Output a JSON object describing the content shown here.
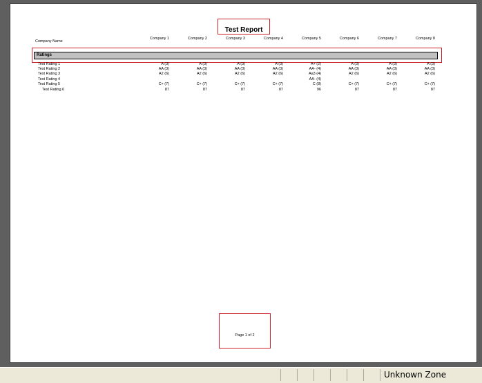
{
  "report": {
    "title": "Test Report",
    "company_name_label": "Company Name",
    "companies": [
      "Company 1",
      "Company 2",
      "Company 3",
      "Company 4",
      "Company 5",
      "Company 6",
      "Company 7",
      "Company 8"
    ],
    "section_title": "Ratings",
    "rows": [
      {
        "label": "Test Rating 1",
        "values": [
          "A (3)",
          "A (3)",
          "A (3)",
          "A (3)",
          "A+ (2)",
          "A (3)",
          "A (3)",
          "A (3)"
        ]
      },
      {
        "label": "Test Rating 2",
        "values": [
          "AA (3)",
          "AA (3)",
          "AA (3)",
          "AA (3)",
          "AA- (4)",
          "AA (3)",
          "AA (3)",
          "AA (3)"
        ]
      },
      {
        "label": "Test Rating 3",
        "values": [
          "A2 (6)",
          "A2 (6)",
          "A2 (6)",
          "A2 (6)",
          "Aa3 (4)",
          "A2 (6)",
          "A2 (6)",
          "A2 (6)"
        ]
      },
      {
        "label": "Test Rating 4",
        "values": [
          "",
          "",
          "",
          "",
          "AA- (4)",
          "",
          "",
          ""
        ]
      },
      {
        "label": "Test Rating 5",
        "values": [
          "C+ (7)",
          "C+ (7)",
          "C+ (7)",
          "C+ (7)",
          "C (8)",
          "C+ (7)",
          "C+ (7)",
          "C+ (7)"
        ]
      },
      {
        "label": "Test Rating 6",
        "values": [
          "87",
          "87",
          "87",
          "87",
          "96",
          "87",
          "87",
          "87"
        ]
      }
    ],
    "footer": "Page 1 of 2"
  },
  "statusbar": {
    "zone": "Unknown Zone"
  }
}
